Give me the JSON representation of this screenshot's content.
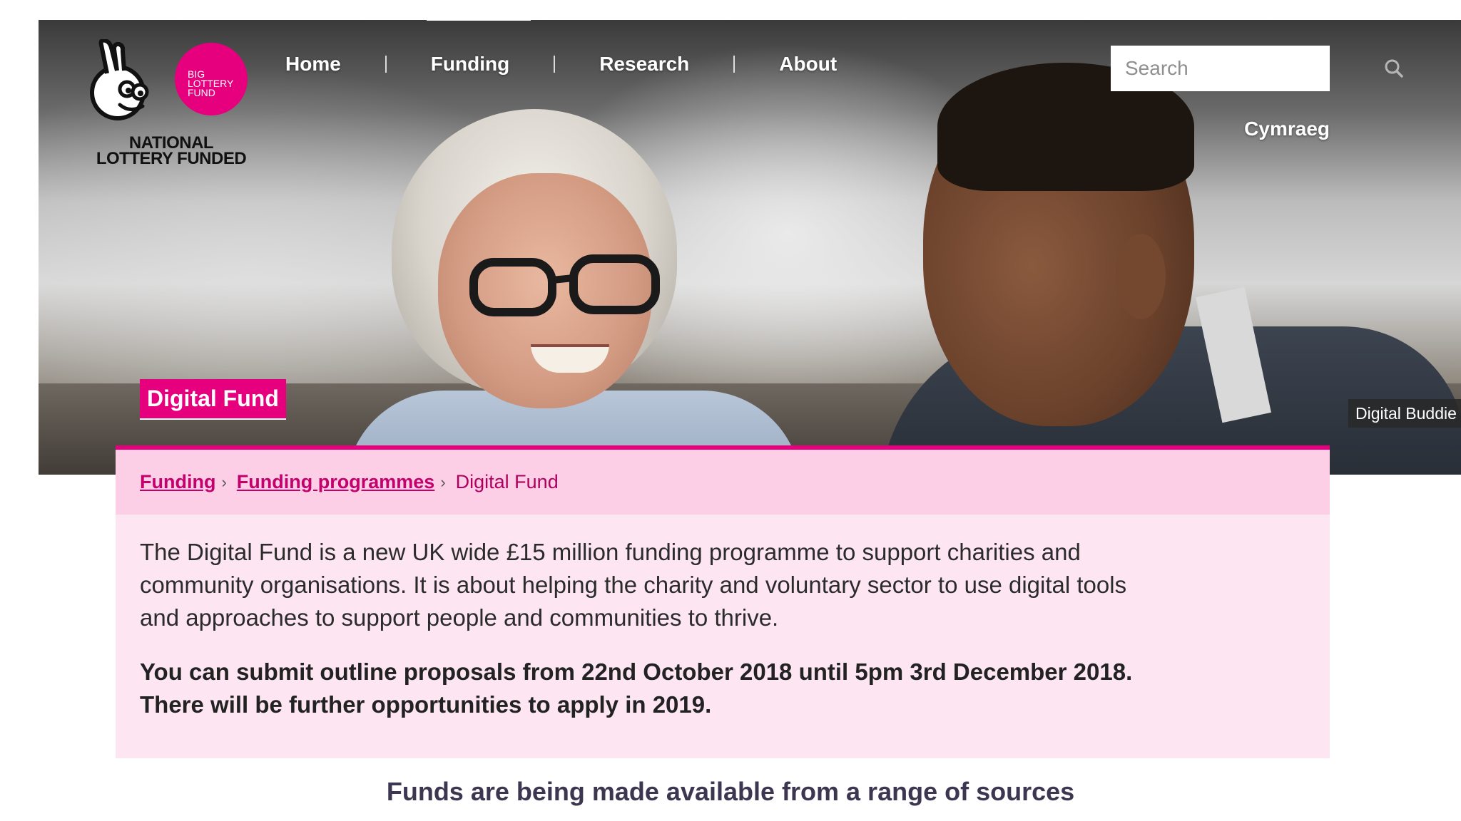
{
  "logo": {
    "big_lottery_fund": [
      "BIG",
      "LOTTERY",
      "FUND"
    ],
    "national_lottery_funded": [
      "NATIONAL",
      "LOTTERY FUNDED"
    ],
    "brand_color": "#e6007e"
  },
  "nav": {
    "items": [
      {
        "label": "Home"
      },
      {
        "label": "Funding"
      },
      {
        "label": "Research"
      },
      {
        "label": "About"
      }
    ]
  },
  "search": {
    "placeholder": "Search",
    "icon": "search-icon"
  },
  "language_link": "Cymraeg",
  "hero": {
    "programme_badge": "Digital Fund",
    "photo_caption": "Digital Buddie"
  },
  "breadcrumb": {
    "items": [
      {
        "label": "Funding"
      },
      {
        "label": "Funding programmes"
      }
    ],
    "current": "Digital Fund"
  },
  "content": {
    "intro": "The Digital Fund is a new UK wide £15 million funding programme to support charities and community organisations. It is about helping the charity and voluntary sector to use digital tools and approaches to support people and communities to thrive.",
    "deadline": "You can submit outline proposals from 22nd October 2018 until 5pm 3rd December 2018. There will be further opportunities to apply in 2019."
  },
  "caption": "Funds are being made available from a range of sources"
}
